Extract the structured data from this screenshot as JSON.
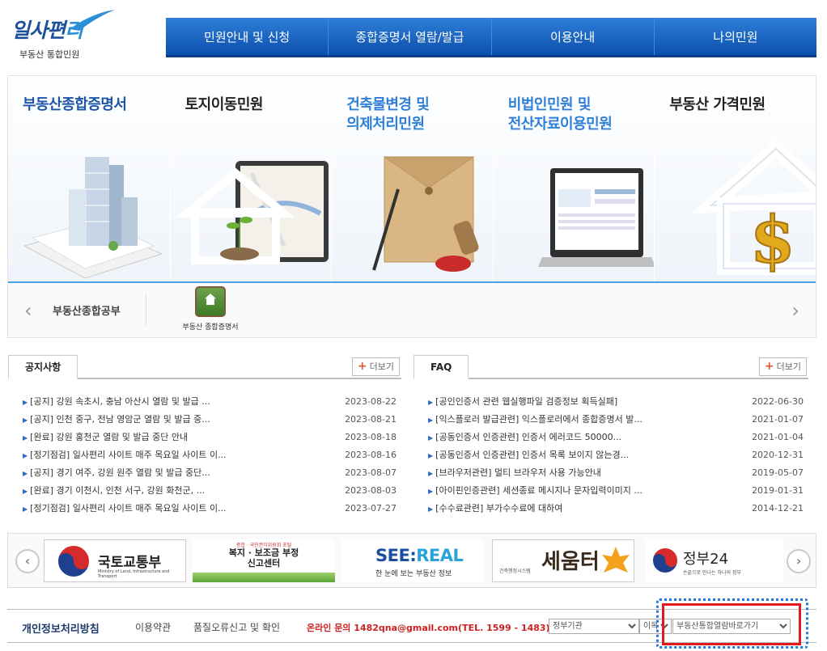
{
  "header": {
    "logo_text_main": "일사편",
    "logo_text_accent": "리",
    "logo_sub": "부동산 통합민원",
    "menu": [
      {
        "label": "민원안내 및 신청"
      },
      {
        "label": "종합증명서 열람/발급"
      },
      {
        "label": "이용안내"
      },
      {
        "label": "나의민원"
      }
    ]
  },
  "banner": {
    "panels": [
      {
        "title": "부동산종합증명서"
      },
      {
        "title": "토지이동민원"
      },
      {
        "title_line1": "건축물변경 및",
        "title_line2": "의제처리민원"
      },
      {
        "title_line1": "비법인민원 및",
        "title_line2": "전산자료이용민원"
      },
      {
        "title": "부동산 가격민원"
      }
    ],
    "quick_label": "부동산종합공부",
    "quick_items": [
      {
        "label": "부동산 종합증명서"
      }
    ]
  },
  "notice": {
    "tab": "공지사항",
    "more": "더보기",
    "items": [
      {
        "title": "[공지] 강원 속초시, 충남 아산시 열람 및 발급 ...",
        "date": "2023-08-22"
      },
      {
        "title": "[공지] 인천 중구, 전남 영암군 열람 및 발급 중...",
        "date": "2023-08-21"
      },
      {
        "title": "[완료] 강원 홍천군 열람 및 발급 중단 안내",
        "date": "2023-08-18"
      },
      {
        "title": "[정기점검] 일사편리 사이트 매주 목요일 사이트 이...",
        "date": "2023-08-16"
      },
      {
        "title": "[공지] 경기 여주, 강원 원주 열람 및 발급 중단...",
        "date": "2023-08-07"
      },
      {
        "title": "[완료] 경기 이천시, 인천 서구, 강원 화천군, ...",
        "date": "2023-08-03"
      },
      {
        "title": "[정기점검] 일사편리 사이트 매주 목요일 사이트 이...",
        "date": "2023-07-27"
      }
    ]
  },
  "faq": {
    "tab": "FAQ",
    "more": "더보기",
    "items": [
      {
        "title": "[공인인증서 관련 웹실행파일 검증정보 획득실패]",
        "date": "2022-06-30"
      },
      {
        "title": "[익스플로러 발급관련] 익스플로러에서 종합증명서 발...",
        "date": "2021-01-07"
      },
      {
        "title": "[공동인증서 인증관련] 인증서 에러코드 50000...",
        "date": "2021-01-04"
      },
      {
        "title": "[공동인증서 인증관련] 인증서 목록 보이지 않는경...",
        "date": "2020-12-31"
      },
      {
        "title": "[브라우저관련] 멀티 브라우저 사용 가능안내",
        "date": "2019-05-07"
      },
      {
        "title": "[아이핀인증관련] 세션종료 메시지나 문자입력이미지 ...",
        "date": "2019-01-31"
      },
      {
        "title": "[수수료관련] 부가수수료에 대하여",
        "date": "2014-12-21"
      }
    ]
  },
  "partners": {
    "molit": {
      "name": "국토교통부",
      "en": "Ministry of Land, Infrastructure and Transport"
    },
    "report": {
      "top": "종합 · 국민권익위원회 포털",
      "line1": "복지 · 보조금 부정",
      "line2": "신고센터"
    },
    "seereal": {
      "name_a": "SEE:",
      "name_b": "REAL",
      "sub": "한 눈에 보는 부동산 정보"
    },
    "seumteo": {
      "small": "건축행정시스템",
      "name": "세움터"
    },
    "gov24": {
      "name": "정부24",
      "sub": "손끝으로 만나는 하나의 정부"
    }
  },
  "footer": {
    "privacy": "개인정보처리방침",
    "terms": "이용약관",
    "quality": "품질오류신고 및 확인",
    "contact": "온라인 문의 1482qna@gmail.com(TEL. 1599 - 1483)",
    "select_gov": "정부기관",
    "select_org": "이목",
    "select_shortcut": "부동산통합열람바로가기"
  },
  "colors": {
    "gnb": "#0b4fad",
    "accent": "#2f7fd8",
    "highlight_red": "#e21a1a",
    "highlight_dotted": "#1e7be0"
  }
}
